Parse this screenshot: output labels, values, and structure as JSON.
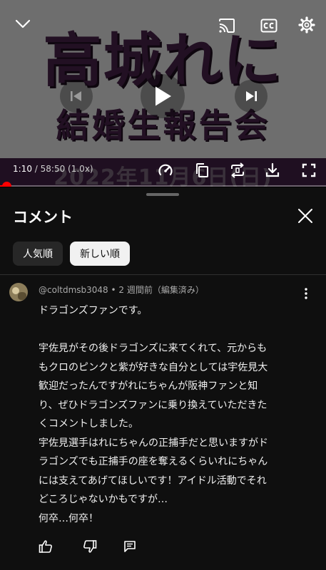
{
  "player": {
    "thumbnail": {
      "title": "高城れに",
      "subtitle": "結婚生報告会",
      "date": "2022年11月6日(日)"
    },
    "time": {
      "current": "1:10",
      "separator": " / ",
      "duration": "58:50",
      "speed": "(1.0x)"
    },
    "progress_fraction": 0.02,
    "colors": {
      "progress": "#ff0000",
      "thumbnail_text": "#3e1e40"
    },
    "icons": {
      "collapse": "chevron-down-icon",
      "cast": "cast-icon",
      "captions": "captions-icon",
      "settings": "gear-icon",
      "previous": "skip-previous-icon",
      "play": "play-icon",
      "next": "skip-next-icon",
      "speed": "speedometer-icon",
      "clip": "copy-icon",
      "loop": "repeat-icon",
      "download": "download-icon",
      "fullscreen": "fullscreen-icon"
    }
  },
  "comments_panel": {
    "title": "コメント",
    "sort_chips": [
      {
        "label": "人気順",
        "selected": false
      },
      {
        "label": "新しい順",
        "selected": true
      }
    ],
    "comment": {
      "author": "@coltdmsb3048",
      "meta_separator": " • ",
      "time": "2 週間前",
      "edited": "（編集済み）",
      "lines": [
        "ドラゴンズファンです。",
        "",
        "宇佐見がその後ドラゴンズに来てくれて、元からも",
        "もクロのピンクと紫が好きな自分としては宇佐見大",
        "歓迎だったんですがれにちゃんが阪神ファンと知",
        "り、ぜひドラゴンズファンに乗り換えていただきた",
        "くコメントしました。",
        "宇佐見選手はれにちゃんの正捕手だと思いますがド",
        "ラゴンズでも正捕手の座を奪えるくらいれにちゃん",
        "には支えてあげてほしいです！アイドル活動でそれ",
        "どころじゃないかもですが…",
        "何卒…何卒！"
      ],
      "actions": [
        "like-icon",
        "dislike-icon",
        "reply-icon"
      ]
    }
  }
}
